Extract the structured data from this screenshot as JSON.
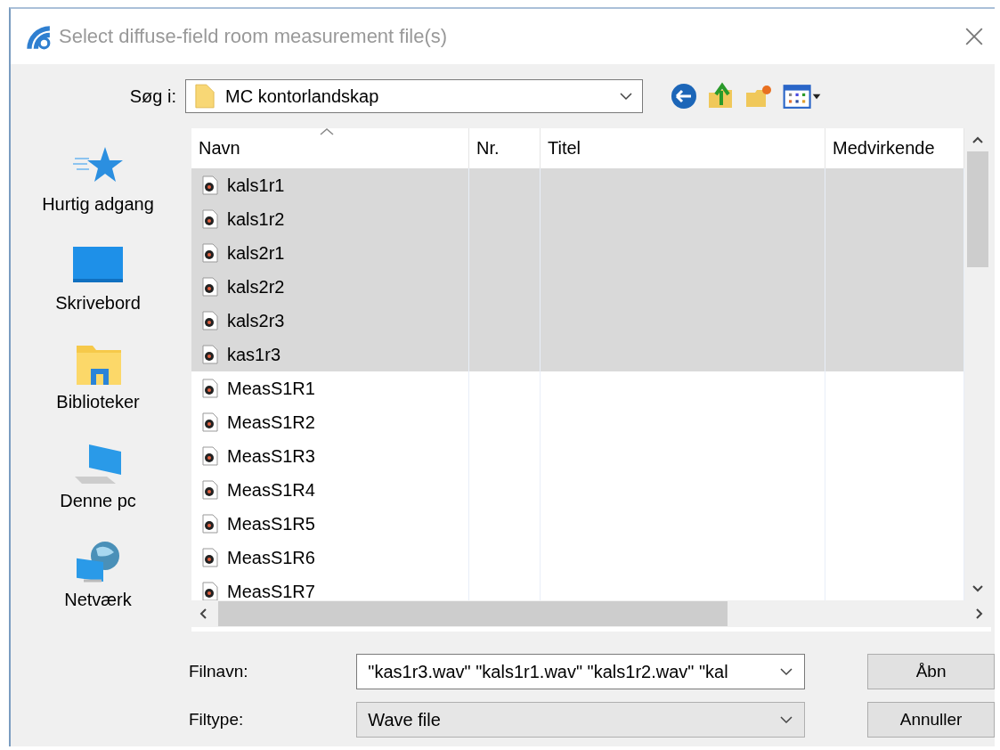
{
  "window": {
    "title": "Select diffuse-field room measurement file(s)"
  },
  "look_in": {
    "label": "Søg i:",
    "value": "MC kontorlandskap"
  },
  "places": [
    {
      "label": "Hurtig adgang",
      "kind": "star"
    },
    {
      "label": "Skrivebord",
      "kind": "desktop"
    },
    {
      "label": "Biblioteker",
      "kind": "library"
    },
    {
      "label": "Denne pc",
      "kind": "pc"
    },
    {
      "label": "Netværk",
      "kind": "network"
    }
  ],
  "columns": [
    "Navn",
    "Nr.",
    "Titel",
    "Medvirkende"
  ],
  "files": [
    {
      "name": "kals1r1",
      "selected": true
    },
    {
      "name": "kals1r2",
      "selected": true
    },
    {
      "name": "kals2r1",
      "selected": true
    },
    {
      "name": "kals2r2",
      "selected": true
    },
    {
      "name": "kals2r3",
      "selected": true
    },
    {
      "name": "kas1r3",
      "selected": true
    },
    {
      "name": "MeasS1R1",
      "selected": false
    },
    {
      "name": "MeasS1R2",
      "selected": false
    },
    {
      "name": "MeasS1R3",
      "selected": false
    },
    {
      "name": "MeasS1R4",
      "selected": false
    },
    {
      "name": "MeasS1R5",
      "selected": false
    },
    {
      "name": "MeasS1R6",
      "selected": false
    },
    {
      "name": "MeasS1R7",
      "selected": false
    }
  ],
  "filename": {
    "label": "Filnavn:",
    "value": "\"kas1r3.wav\" \"kals1r1.wav\" \"kals1r2.wav\" \"kal"
  },
  "filetype": {
    "label": "Filtype:",
    "value": "Wave file"
  },
  "buttons": [
    "Åbn",
    "Annuller"
  ]
}
